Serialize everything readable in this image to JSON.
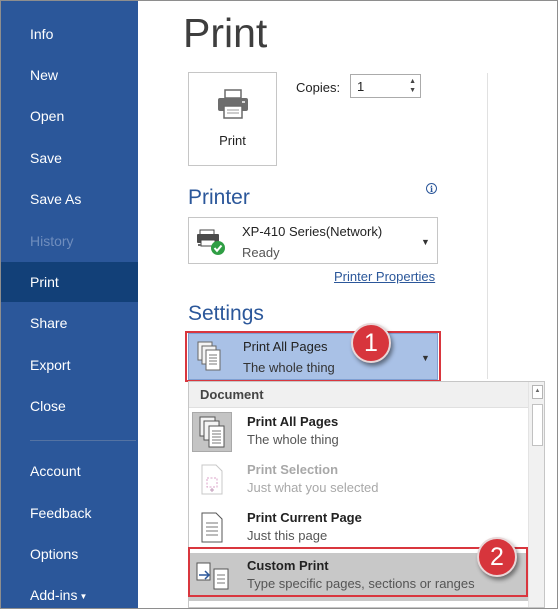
{
  "sidebar": {
    "items": [
      {
        "label": "Info"
      },
      {
        "label": "New"
      },
      {
        "label": "Open"
      },
      {
        "label": "Save"
      },
      {
        "label": "Save As"
      },
      {
        "label": "History",
        "disabled": true
      },
      {
        "label": "Print",
        "active": true
      },
      {
        "label": "Share"
      },
      {
        "label": "Export"
      },
      {
        "label": "Close"
      },
      {
        "label": "Account"
      },
      {
        "label": "Feedback"
      },
      {
        "label": "Options"
      },
      {
        "label": "Add-ins"
      }
    ]
  },
  "main": {
    "title": "Print",
    "print_button_label": "Print",
    "copies_label": "Copies:",
    "copies_value": "1"
  },
  "printer": {
    "heading": "Printer",
    "name": "XP-410 Series(Network)",
    "status": "Ready",
    "properties_link": "Printer Properties"
  },
  "settings": {
    "heading": "Settings",
    "selected_main": "Print All Pages",
    "selected_sub": "The whole thing",
    "badge_1": "1",
    "badge_2": "2"
  },
  "menu": {
    "header": "Document",
    "options": [
      {
        "main": "Print All Pages",
        "sub": "The whole thing",
        "icon": "print-all-pages-icon",
        "state": "selected"
      },
      {
        "main": "Print Selection",
        "sub": "Just what you selected",
        "icon": "print-selection-icon",
        "state": "disabled"
      },
      {
        "main": "Print Current Page",
        "sub": "Just this page",
        "icon": "print-current-page-icon",
        "state": "normal"
      },
      {
        "main": "Custom Print",
        "sub": "Type specific pages, sections or ranges",
        "icon": "custom-print-icon",
        "state": "highlighted"
      }
    ]
  },
  "colors": {
    "sidebar": "#2b579a",
    "sidebar_active": "#124078",
    "accent": "#2b579a",
    "annotation_red": "#d7353c",
    "settings_highlight": "#a9c1e6"
  }
}
